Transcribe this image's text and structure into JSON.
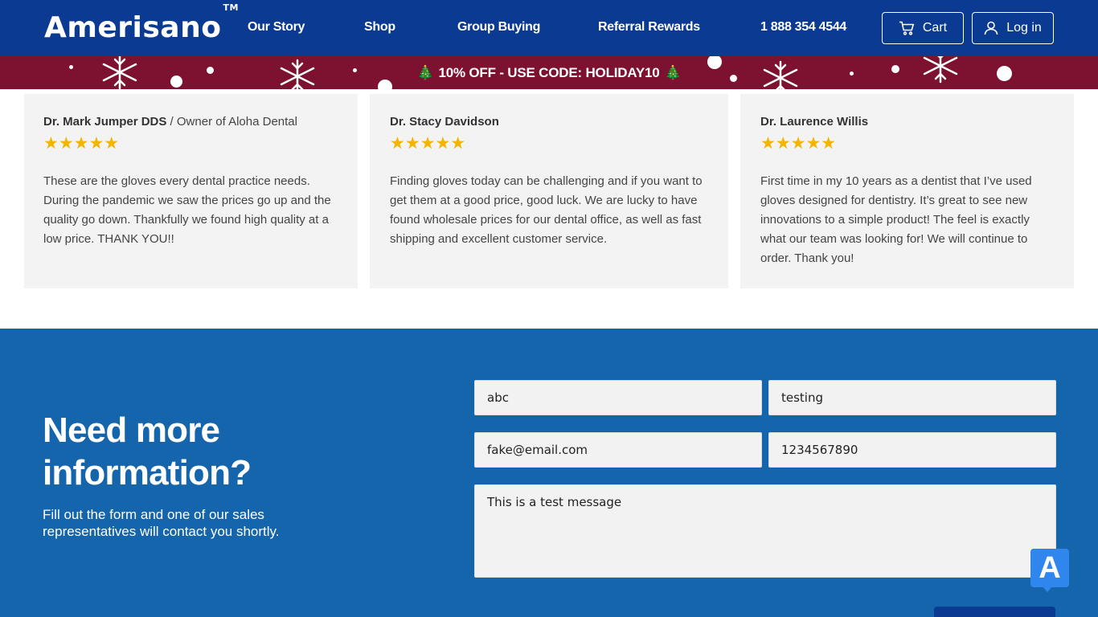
{
  "header": {
    "logo": "Amerisano",
    "logo_mark": "TM",
    "nav": [
      "Our Story",
      "Shop",
      "Group Buying",
      "Referral Rewards"
    ],
    "phone": "1 888 354 4544",
    "cart_label": "Cart",
    "login_label": "Log in",
    "cart_icon": "cart-icon",
    "login_icon": "user-icon"
  },
  "promo": {
    "text": "10% OFF - USE CODE: HOLIDAY10",
    "icon_left": "🎄",
    "icon_right": "🎄"
  },
  "reviews": [
    {
      "name": "Dr. Mark Jumper DDS",
      "title": " / Owner of Aloha Dental",
      "rating": 5,
      "stars": "★★★★★",
      "text": "These are the gloves every dental practice needs. During the pandemic we saw the prices go up and the quality go down. Thankfully we found high quality at a low price. THANK YOU!!"
    },
    {
      "name": "Dr. Stacy Davidson",
      "title": "",
      "rating": 5,
      "stars": "★★★★★",
      "text": "Finding gloves today can be challenging and if you want to get them at a good price, good luck. We are lucky to have found wholesale prices for our dental office, as well as fast shipping and excellent customer service."
    },
    {
      "name": "Dr. Laurence Willis",
      "title": "",
      "rating": 5,
      "stars": "★★★★★",
      "text": "First time in my 10 years as a dentist that I’ve used gloves designed for dentistry. It’s great to see new innovations to a simple product! The feel is exactly what our team was looking for! We will continue to order. Thank you!"
    }
  ],
  "contact": {
    "heading": "Need more information?",
    "subtext": "Fill out the form and one of our sales representatives will contact you shortly.",
    "fields": {
      "first_name": "abc",
      "last_name": "testing",
      "email": "fake@email.com",
      "phone": "1234567890",
      "message": "This is a test message"
    }
  },
  "widget": {
    "label": "A"
  },
  "colors": {
    "header_bg": "#0a3a91",
    "promo_bg": "#7d1230",
    "contact_bg": "#1565ad",
    "star": "#f2b600"
  }
}
